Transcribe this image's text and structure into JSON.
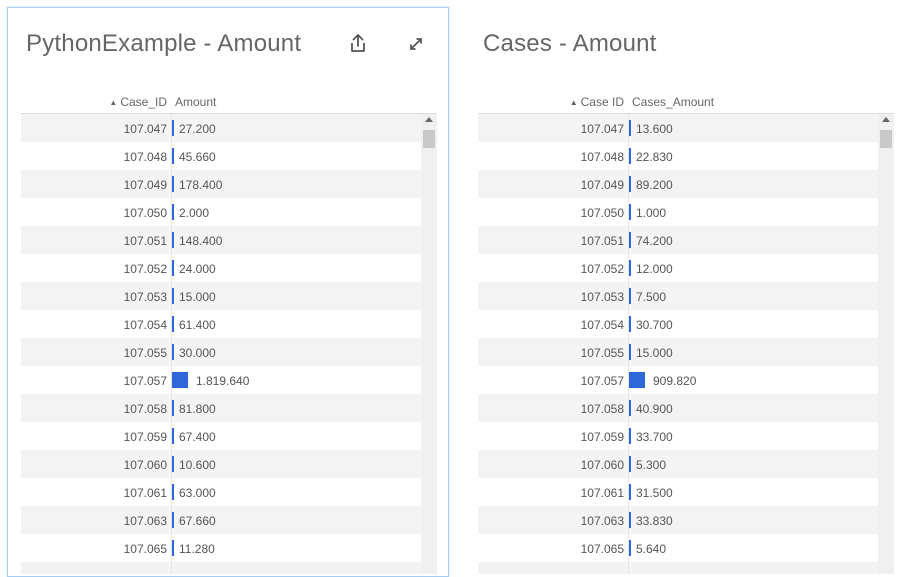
{
  "colors": {
    "bar": "#2d67d8",
    "selected_border": "#a9cdee"
  },
  "panels": [
    {
      "title": "PythonExample - Amount",
      "sort_indicator": "▲",
      "col_case": "Case_ID",
      "col_amount": "Amount",
      "rows": [
        {
          "case_id": "107.047",
          "amount": "27.200",
          "value": 27.2
        },
        {
          "case_id": "107.048",
          "amount": "45.660",
          "value": 45.66
        },
        {
          "case_id": "107.049",
          "amount": "178.400",
          "value": 178.4
        },
        {
          "case_id": "107.050",
          "amount": "2.000",
          "value": 2.0
        },
        {
          "case_id": "107.051",
          "amount": "148.400",
          "value": 148.4
        },
        {
          "case_id": "107.052",
          "amount": "24.000",
          "value": 24.0
        },
        {
          "case_id": "107.053",
          "amount": "15.000",
          "value": 15.0
        },
        {
          "case_id": "107.054",
          "amount": "61.400",
          "value": 61.4
        },
        {
          "case_id": "107.055",
          "amount": "30.000",
          "value": 30.0
        },
        {
          "case_id": "107.057",
          "amount": "1.819.640",
          "value": 1819.64
        },
        {
          "case_id": "107.058",
          "amount": "81.800",
          "value": 81.8
        },
        {
          "case_id": "107.059",
          "amount": "67.400",
          "value": 67.4
        },
        {
          "case_id": "107.060",
          "amount": "10.600",
          "value": 10.6
        },
        {
          "case_id": "107.061",
          "amount": "63.000",
          "value": 63.0
        },
        {
          "case_id": "107.063",
          "amount": "67.660",
          "value": 67.66
        },
        {
          "case_id": "107.065",
          "amount": "11.280",
          "value": 11.28
        },
        {
          "case_id": "",
          "amount": "",
          "value": 0
        }
      ]
    },
    {
      "title": "Cases - Amount",
      "sort_indicator": "▲",
      "col_case": "Case ID",
      "col_amount": "Cases_Amount",
      "rows": [
        {
          "case_id": "107.047",
          "amount": "13.600",
          "value": 13.6
        },
        {
          "case_id": "107.048",
          "amount": "22.830",
          "value": 22.83
        },
        {
          "case_id": "107.049",
          "amount": "89.200",
          "value": 89.2
        },
        {
          "case_id": "107.050",
          "amount": "1.000",
          "value": 1.0
        },
        {
          "case_id": "107.051",
          "amount": "74.200",
          "value": 74.2
        },
        {
          "case_id": "107.052",
          "amount": "12.000",
          "value": 12.0
        },
        {
          "case_id": "107.053",
          "amount": "7.500",
          "value": 7.5
        },
        {
          "case_id": "107.054",
          "amount": "30.700",
          "value": 30.7
        },
        {
          "case_id": "107.055",
          "amount": "15.000",
          "value": 15.0
        },
        {
          "case_id": "107.057",
          "amount": "909.820",
          "value": 909.82
        },
        {
          "case_id": "107.058",
          "amount": "40.900",
          "value": 40.9
        },
        {
          "case_id": "107.059",
          "amount": "33.700",
          "value": 33.7
        },
        {
          "case_id": "107.060",
          "amount": "5.300",
          "value": 5.3
        },
        {
          "case_id": "107.061",
          "amount": "31.500",
          "value": 31.5
        },
        {
          "case_id": "107.063",
          "amount": "33.830",
          "value": 33.83
        },
        {
          "case_id": "107.065",
          "amount": "5.640",
          "value": 5.64
        },
        {
          "case_id": "",
          "amount": "",
          "value": 0
        }
      ]
    }
  ]
}
